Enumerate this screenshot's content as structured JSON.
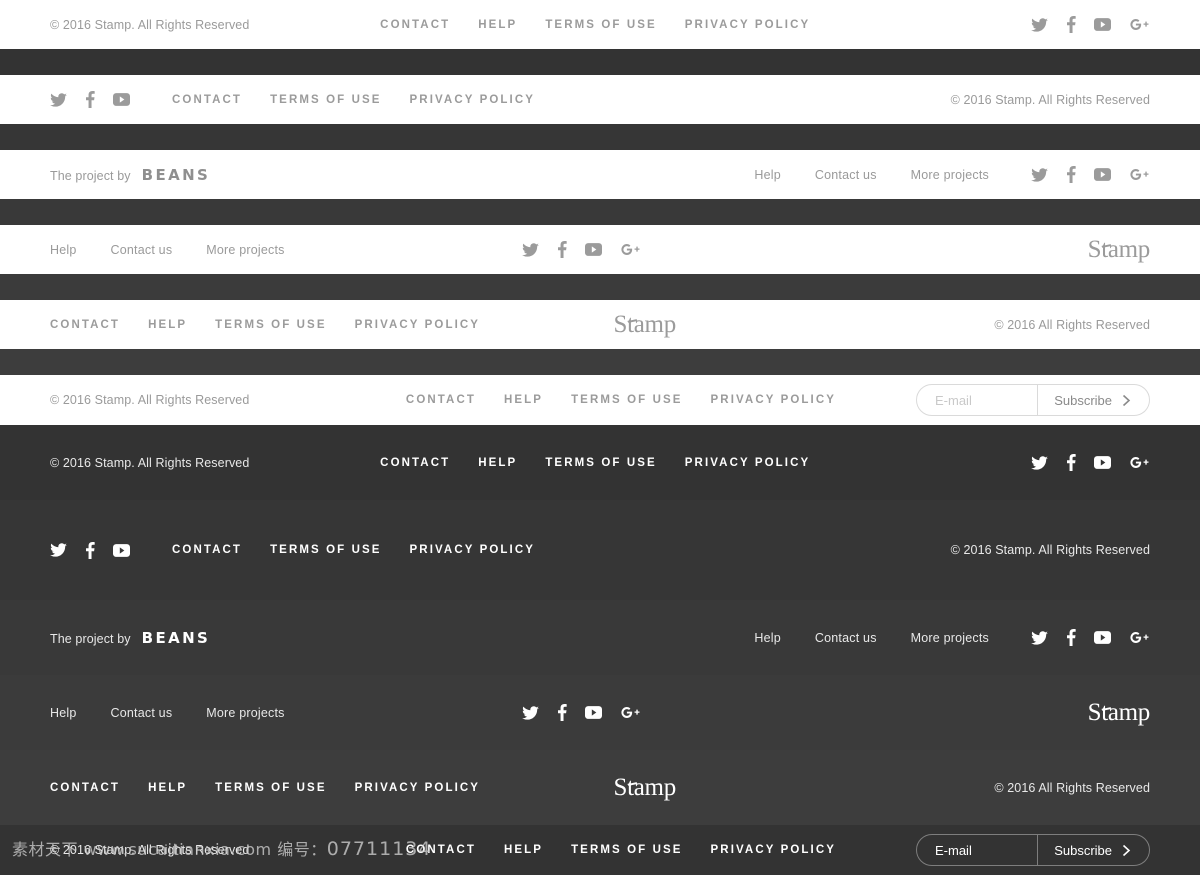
{
  "brand": {
    "stamp": "Stamp",
    "beans": "BEANS",
    "project_by": "The project by"
  },
  "copy": {
    "full": "© 2016 Stamp. All Rights Reserved",
    "short": "© 2016 All Rights Reserved"
  },
  "nav_caps": {
    "contact": "CONTACT",
    "help": "HELP",
    "terms": "TERMS OF USE",
    "privacy": "PRIVACY POLICY"
  },
  "nav_small": {
    "help": "Help",
    "contact_us": "Contact us",
    "more_projects": "More projects"
  },
  "social": {
    "twitter": "twitter-icon",
    "facebook": "facebook-icon",
    "youtube": "youtube-icon",
    "googleplus": "google-plus-icon"
  },
  "subscribe": {
    "placeholder": "E-mail",
    "value": "",
    "button": "Subscribe",
    "arrow": "chevron-right-icon"
  },
  "colors": {
    "dark_bg": "#333333",
    "light_bg": "#ffffff",
    "muted_text": "#9a9a9a",
    "light_text": "#ffffff",
    "border_light": "#dadada",
    "border_dark": "#7e7e7e"
  },
  "watermark": {
    "site": "素材天下 www.sucaitianxia.com",
    "label": "编号：",
    "number": "07711134"
  }
}
